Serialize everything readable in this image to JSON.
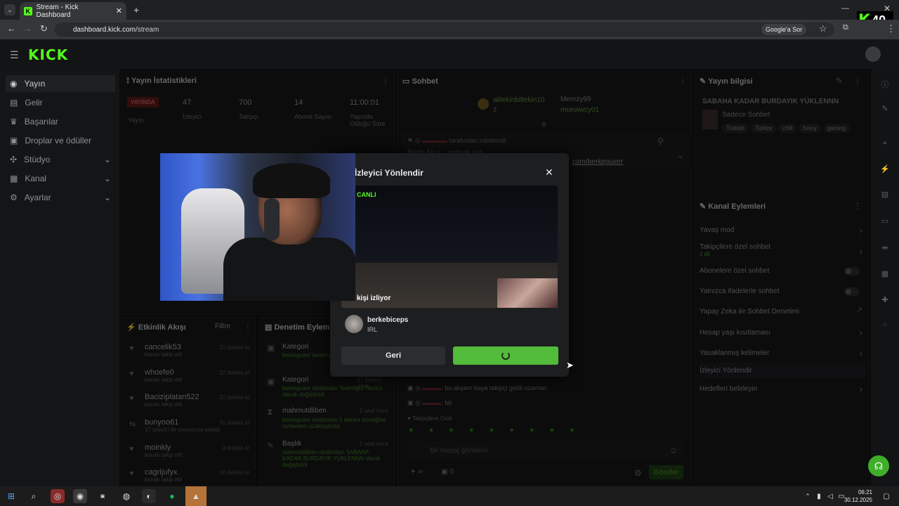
{
  "browser": {
    "tab_title": "Stream - Kick Dashboard",
    "url_host": "dashboard.kick.com",
    "url_path": "/stream",
    "google_label": "Google'a Sor",
    "badge_letter": "K",
    "badge_number": "40"
  },
  "sidebar": {
    "logo": "KICK",
    "items": [
      {
        "label": "Yayın"
      },
      {
        "label": "Gelir"
      },
      {
        "label": "Başarılar"
      },
      {
        "label": "Droplar ve ödüller"
      },
      {
        "label": "Stüdyo"
      },
      {
        "label": "Kanal"
      },
      {
        "label": "Ayarlar"
      }
    ]
  },
  "stats": {
    "title": "Yayın İstatistikleri",
    "live_badge": "YAYINDA",
    "live_label": "Yayın",
    "viewers": "47",
    "viewers_label": "İzleyici",
    "followers": "700",
    "followers_label": "Takipçi",
    "subs": "14",
    "subs_label": "Abone Sayısı",
    "uptime": "11:00:01",
    "uptime_label": "Yayında Olduğu Süre"
  },
  "chat": {
    "title": "Sohbet",
    "top1": "alitekinbiltekin10",
    "top1_count": "3",
    "top2": "Memzy99",
    "top2_count": "2",
    "top3": "muewwcy01",
    "top3_count": "1",
    "pinned_by": "tarafından sabitlendi",
    "pinned_line1": "Bizde bir s... gelmek için",
    "pinned_link": "com/berkeguierr",
    "msg1": "bu akşam baya takipçi geldi ozaman",
    "msg2": "bb",
    "followers_only": "Takipçilere Özel",
    "input_placeholder": "Bir mesaj gönderin",
    "points": "0",
    "send": "Gönder"
  },
  "stream_info": {
    "title": "Yayın bilgisi",
    "stream_title": "SABAHA KADAR BURDAYIK YÜKLENNN",
    "category": "Sadece Sohbet",
    "tags": [
      "Turkish",
      "Türkçe",
      "chill",
      "funny",
      "gaming"
    ]
  },
  "channel_actions": {
    "title": "Kanal Eylemleri",
    "items": [
      {
        "label": "Yavaş mod"
      },
      {
        "label": "Takipçilere özel sohbet",
        "sub": "1 dk"
      },
      {
        "label": "Abonelere özel sohbet"
      },
      {
        "label": "Yalnızca ifadelerle sohbet"
      },
      {
        "label": "Yapay Zeka ile Sohbet Denetimi"
      },
      {
        "label": "Hesap yaşı kısıtlaması"
      },
      {
        "label": "Yasaklanmış kelimeler"
      },
      {
        "label": "İzleyici Yönlendir"
      },
      {
        "label": "Hedefleri belirleyin"
      }
    ]
  },
  "activity": {
    "title": "Etkinlik Akışı",
    "filter": "Filtre",
    "items": [
      {
        "name": "cancelik53",
        "sub": "kanalı takip etti",
        "time": "31 dakika önce"
      },
      {
        "name": "whoefe0",
        "sub": "kanalı takip etti",
        "time": "32 dakika önce"
      },
      {
        "name": "Baciziplatan522",
        "sub": "kanalı takip etti",
        "time": "32 dakika önce"
      },
      {
        "name": "bunyoo61",
        "sub": "17 izleyici ile yayınınıza katıldı",
        "time": "31 dakika önce"
      },
      {
        "name": "moinkly",
        "sub": "kanalı takip etti",
        "time": "4 dakika önce"
      },
      {
        "name": "cagrijufyx",
        "sub": "kanalı takip etti",
        "time": "40 dakika önce"
      }
    ]
  },
  "moderation": {
    "title": "Denetim Eylemleri",
    "items": [
      {
        "head": "Kategori",
        "body": "berkeguierr tarafından ... olarak değiştirildi",
        "time": ""
      },
      {
        "head": "Kategori",
        "body": "berkeguierr tarafından Teamfight Tactics olarak değiştirildi",
        "time": "37 dakika önce"
      },
      {
        "head": "mahmutdliben",
        "body": "berkeguierr tarafından 5 dakika süreliğine sohbetten uzaklaştırıldı",
        "time": "2 saat önce"
      },
      {
        "head": "Başlık",
        "body": "mahmutdliben tarafından SABAHA KADAR BURDAYIK YÜKLENNN olarak değiştirildi",
        "time": "2 saat önce"
      },
      {
        "head": "Başlık",
        "body": "",
        "time": ""
      }
    ]
  },
  "modal": {
    "title": "İzleyici Yönlendir",
    "live_tag": "CANLI",
    "watching": "kişi izliyor",
    "channel": "berkebiceps",
    "category": "IRL",
    "back": "Geri"
  },
  "taskbar": {
    "time": "06:21",
    "date": "30.12.2025"
  },
  "colors": {
    "brand": "#53fc18",
    "confirm": "#53bb3a"
  }
}
